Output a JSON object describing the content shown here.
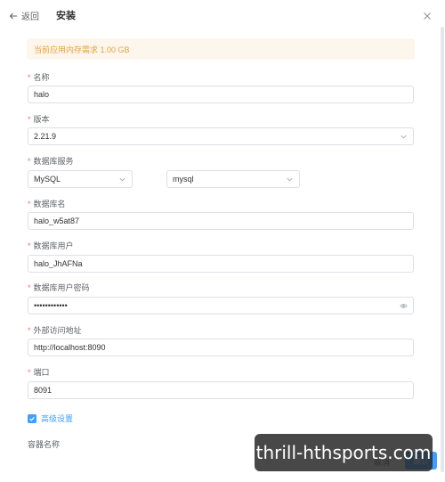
{
  "header": {
    "back_label": "返回",
    "title": "安装"
  },
  "alert": {
    "text": "当前应用内存需求 1.00 GB"
  },
  "form": {
    "name": {
      "label": "名称",
      "value": "halo"
    },
    "version": {
      "label": "版本",
      "value": "2.21.9"
    },
    "db_service": {
      "label": "数据库服务",
      "type_value": "MySQL",
      "instance_value": "mysql"
    },
    "db_name": {
      "label": "数据库名",
      "value": "halo_w5at87"
    },
    "db_user": {
      "label": "数据库用户",
      "value": "halo_JhAFNa"
    },
    "db_password": {
      "label": "数据库用户密码",
      "value": "••••••••••••"
    },
    "external_url": {
      "label": "外部访问地址",
      "value": "http://localhost:8090"
    },
    "port": {
      "label": "端口",
      "value": "8091"
    },
    "advanced": {
      "label": "高级设置"
    },
    "container_name": {
      "label": "容器名称"
    }
  },
  "footer": {
    "cancel_label": "取消",
    "confirm_label": "确认"
  },
  "watermark": {
    "text": "thrill-hthsports.com"
  },
  "colors": {
    "primary": "#409eff",
    "warning": "#e6a23c",
    "warning_bg": "#fdf6ec",
    "required": "#f56c6c"
  }
}
